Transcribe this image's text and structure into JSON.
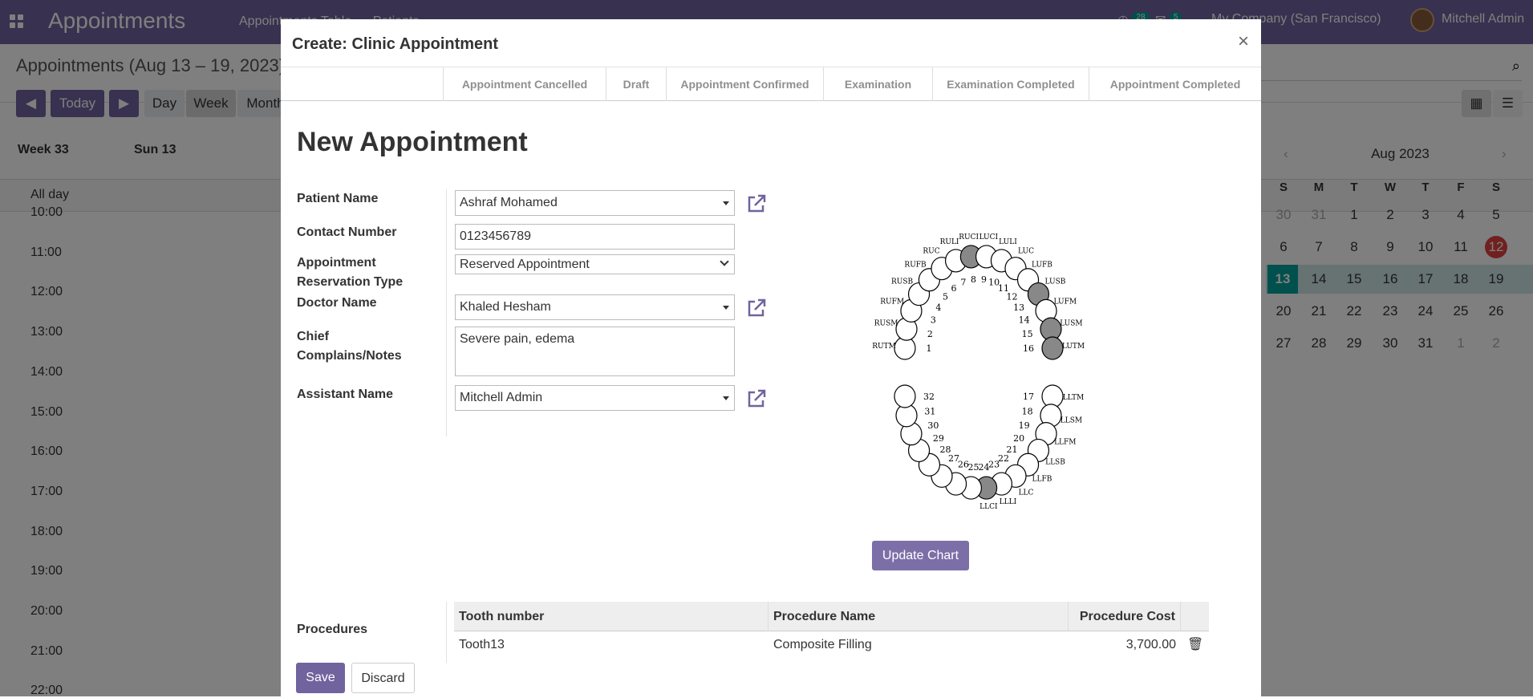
{
  "navbar": {
    "app_title": "Appointments",
    "menu": [
      "Appointments Table",
      "Patients"
    ],
    "activity_count": "28",
    "message_count": "5",
    "company": "My Company (San Francisco)",
    "user": "Mitchell Admin"
  },
  "control_panel": {
    "title": "Appointments (Aug 13 – 19, 2023)",
    "today": "Today",
    "scales": [
      "Day",
      "Week",
      "Month"
    ]
  },
  "calendar": {
    "week_label": "Week 33",
    "first_day": "Sun 13",
    "all_day": "All day",
    "hours": [
      "10:00",
      "11:00",
      "12:00",
      "13:00",
      "14:00",
      "15:00",
      "16:00",
      "17:00",
      "18:00",
      "19:00",
      "20:00",
      "21:00",
      "22:00"
    ]
  },
  "mini_calendar": {
    "month": "Aug 2023",
    "weekdays": [
      "S",
      "M",
      "T",
      "W",
      "T",
      "F",
      "S"
    ],
    "weeks": [
      [
        "30",
        "31",
        "1",
        "2",
        "3",
        "4",
        "5"
      ],
      [
        "6",
        "7",
        "8",
        "9",
        "10",
        "11",
        "12"
      ],
      [
        "13",
        "14",
        "15",
        "16",
        "17",
        "18",
        "19"
      ],
      [
        "20",
        "21",
        "22",
        "23",
        "24",
        "25",
        "26"
      ],
      [
        "27",
        "28",
        "29",
        "30",
        "31",
        "1",
        "2"
      ]
    ],
    "today": "12",
    "selected_week_start": "13"
  },
  "modal": {
    "title": "Create: Clinic Appointment",
    "close": "×",
    "stages": [
      "Appointment Cancelled",
      "Draft",
      "Appointment Confirmed",
      "Examination",
      "Examination Completed",
      "Appointment Completed"
    ],
    "heading": "New Appointment",
    "fields": {
      "patient_label": "Patient Name",
      "patient_value": "Ashraf Mohamed",
      "contact_label": "Contact Number",
      "contact_value": "0123456789",
      "type_label_1": "Appointment",
      "type_label_2": "Reservation Type",
      "type_value": "Reserved Appointment",
      "doctor_label": "Doctor Name",
      "doctor_value": "Khaled Hesham",
      "complaints_label_1": "Chief",
      "complaints_label_2": "Complains/Notes",
      "complaints_value": "Severe pain, edema",
      "assistant_label": "Assistant Name",
      "assistant_value": "Mitchell Admin"
    },
    "update_chart": "Update Chart",
    "procedures_label": "Procedures",
    "procedures_table": {
      "columns": [
        "Tooth number",
        "Procedure Name",
        "Procedure Cost"
      ],
      "rows": [
        [
          "Tooth13",
          "Composite Filling",
          "3,700.00"
        ]
      ]
    },
    "save": "Save",
    "discard": "Discard"
  },
  "tooth_chart": {
    "teeth": [
      "1",
      "2",
      "3",
      "4",
      "5",
      "6",
      "7",
      "8",
      "9",
      "10",
      "11",
      "12",
      "13",
      "14",
      "15",
      "16",
      "17",
      "18",
      "19",
      "20",
      "21",
      "22",
      "23",
      "24",
      "25",
      "26",
      "27",
      "28",
      "29",
      "30",
      "31",
      "32"
    ],
    "upper_codes": [
      "RUTM",
      "RUSM",
      "RUFM",
      "RUSB",
      "RUFB",
      "RUC",
      "RULI",
      "RUCI",
      "LUCI",
      "LULI",
      "LUC",
      "LUFB",
      "LUSB",
      "LUFM",
      "LUSM",
      "LUTM"
    ],
    "lower_codes": [
      "LLTM",
      "LLSM",
      "LLFM",
      "LLSB",
      "LLFB",
      "LLC",
      "LLLI",
      "LLCI"
    ],
    "highlighted": [
      "8",
      "13",
      "15",
      "16",
      "24"
    ],
    "highlight_color": "#888888"
  },
  "colors": {
    "brand": "#71639e",
    "accent": "#00a09d",
    "today": "#e04040"
  }
}
